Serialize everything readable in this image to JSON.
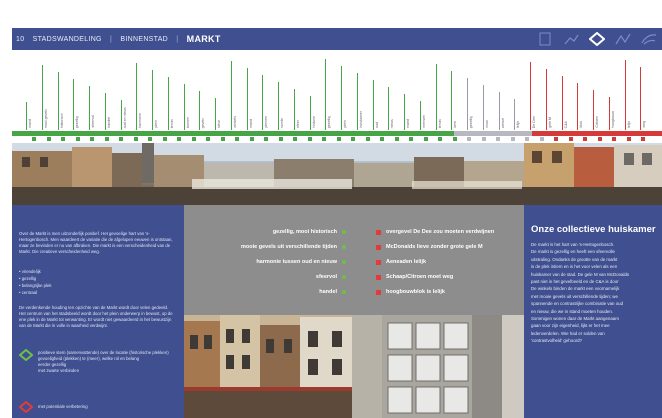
{
  "header": {
    "number": "10",
    "crumb1": "STADSWANDELING",
    "crumb2": "BINNENSTAD",
    "current": "MARKT",
    "icons": [
      "document-icon",
      "person-walk-icon",
      "diamond-icon",
      "person-walk-icon",
      "wind-icon"
    ]
  },
  "colors": {
    "blue": "#3f4f8f",
    "green": "#47a447",
    "red": "#d43a3a",
    "grey": "#8d8d8d"
  },
  "left_panel": {
    "intro": "Over de Markt is men uitzonderlijk positief. Het gevoelige hart van 's-Hertogenbosch. Men waardeert de variatie die de afgelopen eeuwen is ontstaan, maar ze bevinden er nu van afbraken. Die markt is een verscheidenheid van de Markt. Die creatieve verscheidenheid weg.",
    "bullets": [
      "vriendelijk",
      "gezellig",
      "belangrijke plek",
      "centraal"
    ],
    "para2": "De verdenkende houding ten opzichte van de Markt wordt door velen gedeeld. Het centrum van het stadsbeeld wordt door het plein onderwerp in bewust, op de ene plek in de Markt tot verwanting. Er wordt niet gewaardeerd in het bewustzijn van de Markt die in volle in waarheid verdwijnt.",
    "legend_green": [
      "positieve stem (samenvattende) over de locatie (historische plekken)",
      "gevoeligheid (plekken) te (meer), welke rol en belang",
      "eerder gezellig",
      "met zwarte verbinden"
    ],
    "legend_red": "met potentiale verbetering"
  },
  "middle_panel": {
    "positives": [
      "gezellig, mooi historisch",
      "mooie gevels uit verschillende tijden",
      "harmonie tussen oud en nieuw",
      "sfeervol",
      "handel"
    ],
    "negatives": [
      "overgevel De Dee zou moeten verdwijnen",
      "McDonalds lieve zonder grote gele M",
      "Aeneaden lelijk",
      "Schaap/Citroen moet weg",
      "hoogbouwblok is lelijk"
    ]
  },
  "right_panel": {
    "title": "Onze collectieve huiskamer",
    "lines": [
      "De markt is het hart van 's-Hertogenbosch.",
      "De markt is gezellig en heeft een sfeervolle",
      "uitstraling. Ondanks de grootte van de markt",
      "is de plek intiem en is het voor velen als een",
      "huiskamer van de stad. De gele M van McDonalds",
      "past niet in het gevelbeeld en de C&A is door",
      "De winkels binden de markt een voornamelijk",
      "met mooie gevels uit verschillende tijden; we",
      "spannende en contrastrijke combinatie van oud",
      "en nieuw, die we in stand moeten houden.",
      "Sommigen wonen daar de Markt aangenaam",
      "gaan voor zijn eigenheid, lijkt er het mee",
      "ledenverdelen. Wie had er solden van",
      "'contrastvolheid' gehoord?"
    ]
  },
  "vertical_labels": [
    "markt",
    "mooi gevels",
    "historisch",
    "gezellig",
    "sfeervol",
    "handel",
    "oud en nieuw",
    "harmonie",
    "plein",
    "terras",
    "bomen",
    "gevels",
    "kleur",
    "winkels",
    "markt",
    "pleinen",
    "ruimte",
    "sfeer",
    "historie",
    "gezellig",
    "plein",
    "huiskamer",
    "oud",
    "nieuw",
    "markt",
    "mensen",
    "terras",
    "kerk",
    "gezellig",
    "mooi",
    "winkel",
    "lelijk",
    "De Dee",
    "gele M",
    "C&A",
    "blok",
    "Citroen",
    "hoogbouw",
    "lelijk",
    "weg"
  ]
}
